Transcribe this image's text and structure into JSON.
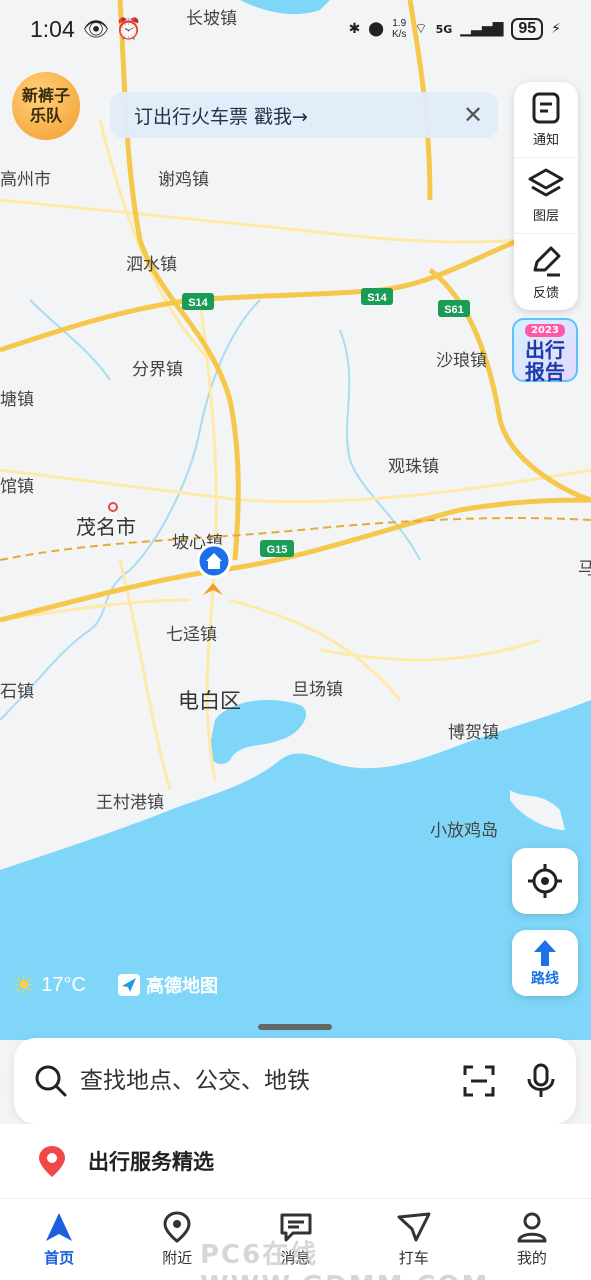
{
  "status_bar": {
    "time": "1:04",
    "net_speed_value": "1.9",
    "net_speed_unit": "K/s",
    "network": "5G",
    "battery": "95"
  },
  "promo_badge": {
    "line1": "新裤子",
    "line2": "乐队"
  },
  "banner": {
    "text": "订出行火车票  戳我→"
  },
  "tools": {
    "notify": "通知",
    "layers": "图层",
    "feedback": "反馈"
  },
  "report": {
    "year": "2023",
    "line1": "出行",
    "line2": "报告"
  },
  "map_labels": [
    "长坡镇",
    "高州市",
    "谢鸡镇",
    "泗水镇",
    "分界镇",
    "沙琅镇",
    "塘镇",
    "观珠镇",
    "馆镇",
    "茂名市",
    "坡心镇",
    "七迳镇",
    "石镇",
    "电白区",
    "旦场镇",
    "博贺镇",
    "王村港镇",
    "小放鸡岛",
    "马"
  ],
  "road_shields": [
    "S14",
    "S14",
    "S61",
    "G15"
  ],
  "weather": {
    "temp": "17°C"
  },
  "brand": {
    "name": "高德地图"
  },
  "route_button": {
    "label": "路线"
  },
  "search": {
    "placeholder": "查找地点、公交、地铁"
  },
  "services": {
    "title": "出行服务精选"
  },
  "nav": [
    {
      "label": "首页"
    },
    {
      "label": "附近"
    },
    {
      "label": "消息"
    },
    {
      "label": "打车"
    },
    {
      "label": "我的"
    }
  ],
  "watermark": "PC6在线 WWW.GDMM.COM",
  "colors": {
    "sea": "#7fd6f8",
    "road_major": "#f5c84c",
    "road_minor": "#fde9a8",
    "accent": "#1b5fe0"
  }
}
